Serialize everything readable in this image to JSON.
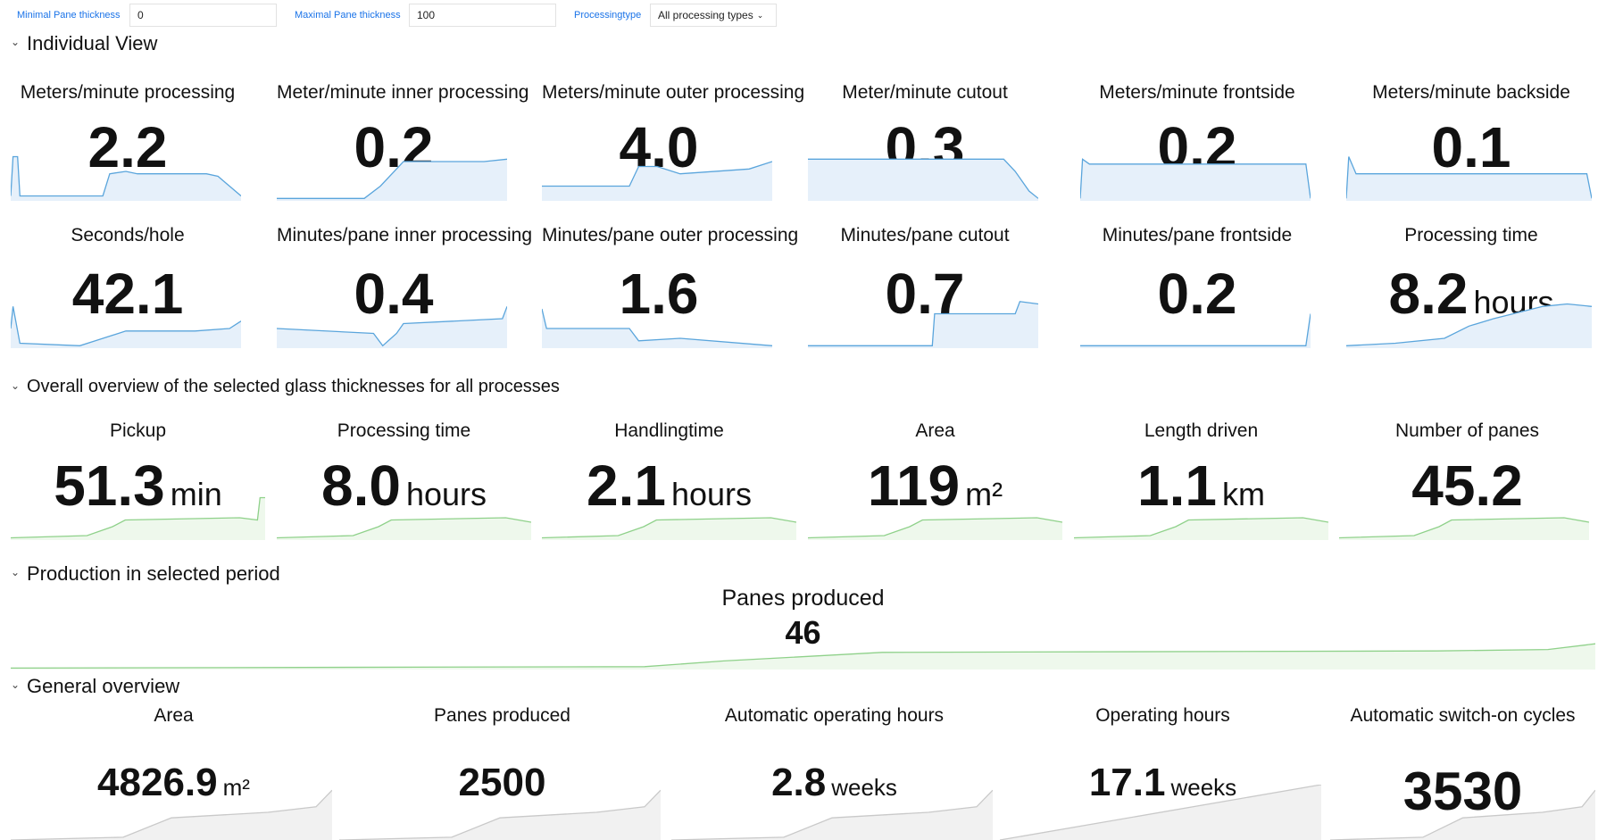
{
  "filters": {
    "min_label": "Minimal Pane thickness",
    "min_value": "0",
    "max_label": "Maximal Pane thickness",
    "max_value": "100",
    "type_label": "Processingtype",
    "type_value": "All processing types"
  },
  "sections": {
    "individual": "Individual View",
    "overall": "Overall overview of the selected glass thicknesses for all processes",
    "production": "Production in selected period",
    "general": "General overview"
  },
  "individual_tiles": [
    {
      "title": "Meters/minute processing",
      "value": "2.2",
      "unit": ""
    },
    {
      "title": "Meter/minute inner processing",
      "value": "0.2",
      "unit": ""
    },
    {
      "title": "Meters/minute outer processing",
      "value": "4.0",
      "unit": ""
    },
    {
      "title": "Meter/minute cutout",
      "value": "0.3",
      "unit": ""
    },
    {
      "title": "Meters/minute frontside",
      "value": "0.2",
      "unit": ""
    },
    {
      "title": "Meters/minute backside",
      "value": "0.1",
      "unit": ""
    },
    {
      "title": "Seconds/hole",
      "value": "42.1",
      "unit": ""
    },
    {
      "title": "Minutes/pane inner processing",
      "value": "0.4",
      "unit": ""
    },
    {
      "title": "Minutes/pane outer processing",
      "value": "1.6",
      "unit": ""
    },
    {
      "title": "Minutes/pane cutout",
      "value": "0.7",
      "unit": ""
    },
    {
      "title": "Minutes/pane frontside",
      "value": "0.2",
      "unit": ""
    },
    {
      "title": "Processing time",
      "value": "8.2",
      "unit": "hours"
    }
  ],
  "overall_tiles": [
    {
      "title": "Pickup",
      "value": "51.3",
      "unit": "min"
    },
    {
      "title": "Processing time",
      "value": "8.0",
      "unit": "hours"
    },
    {
      "title": "Handlingtime",
      "value": "2.1",
      "unit": "hours"
    },
    {
      "title": "Area",
      "value": "119",
      "unit": "m²"
    },
    {
      "title": "Length driven",
      "value": "1.1",
      "unit": "km"
    },
    {
      "title": "Number of panes",
      "value": "45.2",
      "unit": ""
    }
  ],
  "production_tile": {
    "title": "Panes produced",
    "value": "46"
  },
  "general_tiles": [
    {
      "title": "Area",
      "value": "4826.9",
      "unit": "m²"
    },
    {
      "title": "Panes produced",
      "value": "2500",
      "unit": ""
    },
    {
      "title": "Automatic operating hours",
      "value": "2.8",
      "unit": "weeks"
    },
    {
      "title": "Operating hours",
      "value": "17.1",
      "unit": "weeks"
    },
    {
      "title": "Automatic switch-on cycles",
      "value": "3530",
      "unit": ""
    }
  ],
  "colors": {
    "blue_line": "#5aa5dc",
    "blue_fill": "#e6f0fa",
    "green_line": "#8fd18a",
    "green_fill": "#eef8ec",
    "gray_line": "#c9c9c9",
    "gray_fill": "#f1f1f1",
    "label_blue": "#1a73e8"
  },
  "icons": {
    "collapse": "chevron-down-icon",
    "dropdown": "chevron-down-icon"
  }
}
